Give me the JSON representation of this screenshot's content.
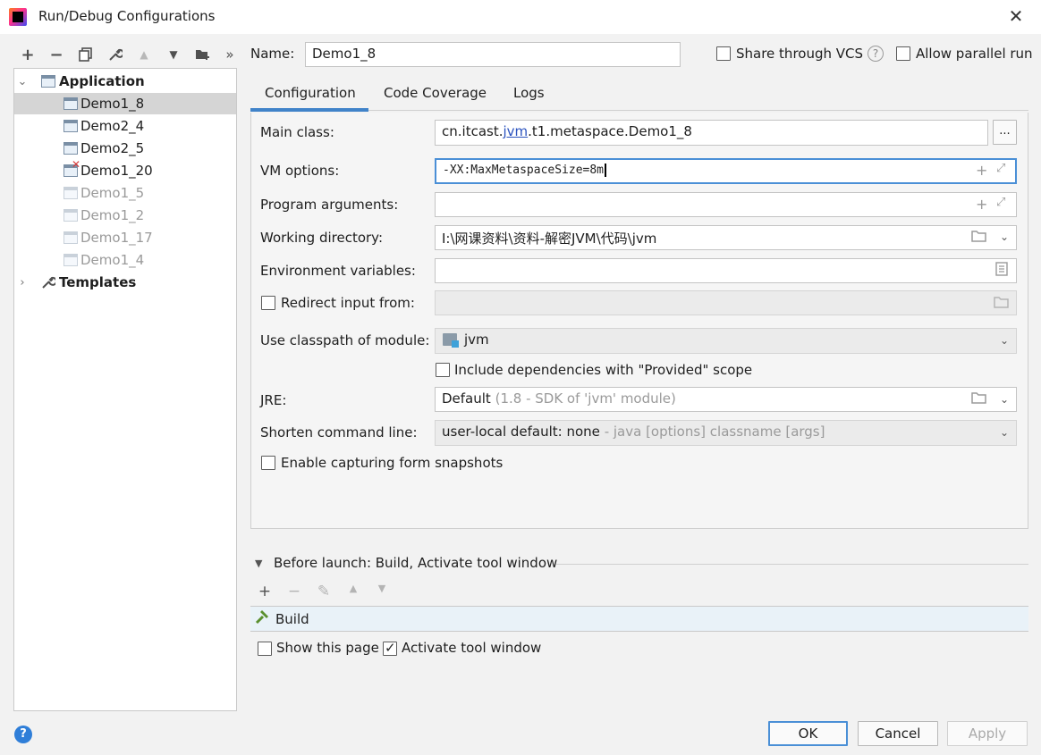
{
  "window": {
    "title": "Run/Debug Configurations"
  },
  "toolbar": {
    "icons": [
      "add-icon",
      "remove-icon",
      "copy-icon",
      "wrench-icon",
      "move-up-icon",
      "move-down-icon",
      "new-folder-icon",
      "more-icon"
    ],
    "more_label": "»"
  },
  "tree": {
    "application_label": "Application",
    "templates_label": "Templates",
    "items": [
      {
        "label": "Demo1_8",
        "selected": true,
        "faded": false
      },
      {
        "label": "Demo2_4",
        "selected": false,
        "faded": false
      },
      {
        "label": "Demo2_5",
        "selected": false,
        "faded": false
      },
      {
        "label": "Demo1_20",
        "selected": false,
        "faded": false,
        "error": true
      },
      {
        "label": "Demo1_5",
        "selected": false,
        "faded": true
      },
      {
        "label": "Demo1_2",
        "selected": false,
        "faded": true
      },
      {
        "label": "Demo1_17",
        "selected": false,
        "faded": true
      },
      {
        "label": "Demo1_4",
        "selected": false,
        "faded": true
      }
    ]
  },
  "header": {
    "name_label": "Name:",
    "name_value": "Demo1_8",
    "share_vcs_label": "Share through VCS",
    "share_vcs_checked": false,
    "help_glyph": "?",
    "allow_parallel_label": "Allow parallel run",
    "allow_parallel_checked": false
  },
  "tabs": [
    {
      "label": "Configuration",
      "active": true
    },
    {
      "label": "Code Coverage",
      "active": false
    },
    {
      "label": "Logs",
      "active": false
    }
  ],
  "form": {
    "main_class_label": "Main class:",
    "main_class_prefix": "cn.itcast.",
    "main_class_link": "jvm",
    "main_class_suffix": ".t1.metaspace.Demo1_8",
    "browse_label": "...",
    "vm_options_label": "VM options:",
    "vm_options_value": "-XX:MaxMetaspaceSize=8m",
    "program_args_label": "Program arguments:",
    "program_args_value": "",
    "working_dir_label": "Working directory:",
    "working_dir_value": "I:\\网课资料\\资料-解密JVM\\代码\\jvm",
    "env_vars_label": "Environment variables:",
    "env_vars_value": "",
    "redirect_label": "Redirect input from:",
    "redirect_checked": false,
    "classpath_label": "Use classpath of module:",
    "classpath_value": "jvm",
    "include_deps_label": "Include dependencies with \"Provided\" scope",
    "include_deps_checked": false,
    "jre_label": "JRE:",
    "jre_value": "Default",
    "jre_hint": "(1.8 - SDK of 'jvm' module)",
    "shorten_label": "Shorten command line:",
    "shorten_value": "user-local default: none",
    "shorten_hint": "- java [options] classname [args]",
    "snapshots_label": "Enable capturing form snapshots",
    "snapshots_checked": false
  },
  "before_launch": {
    "title": "Before launch: Build, Activate tool window",
    "item_label": "Build",
    "show_page_label": "Show this page",
    "show_page_checked": false,
    "activate_label": "Activate tool window",
    "activate_checked": true
  },
  "buttons": {
    "ok": "OK",
    "cancel": "Cancel",
    "apply": "Apply",
    "help": "?"
  }
}
